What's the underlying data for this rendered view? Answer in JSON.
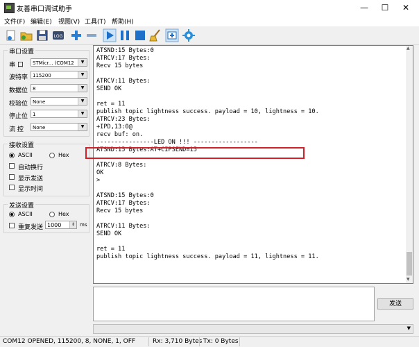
{
  "window": {
    "title": "友善串口调试助手"
  },
  "menu": [
    "文件(F)",
    "编辑(E)",
    "视图(V)",
    "工具(T)",
    "帮助(H)"
  ],
  "toolbar": {
    "icons": [
      "new-icon",
      "open-icon",
      "save-icon",
      "log-icon",
      "add-icon",
      "remove-icon",
      "run-icon",
      "pause-icon",
      "stop-icon",
      "clear-icon",
      "add-window-icon",
      "settings-icon"
    ]
  },
  "serial_settings": {
    "title": "串口设置",
    "port_label": "串  口",
    "port_value": "STMicr... (COM12",
    "baud_label": "波特率",
    "baud_value": "115200",
    "databits_label": "数据位",
    "databits_value": "8",
    "parity_label": "校验位",
    "parity_value": "None",
    "stopbits_label": "停止位",
    "stopbits_value": "1",
    "flow_label": "流  控",
    "flow_value": "None"
  },
  "receive_settings": {
    "title": "接收设置",
    "ascii": "ASCII",
    "hex": "Hex",
    "auto_wrap": "自动换行",
    "show_send": "显示发送",
    "show_time": "显示时间"
  },
  "send_settings": {
    "title": "发送设置",
    "ascii": "ASCII",
    "hex": "Hex",
    "repeat": "重复发送",
    "interval": "1000",
    "unit": "ms"
  },
  "console_text": "ATSND:15 Bytes:0\nATRCV:17 Bytes:\nRecv 15 bytes\n\nATRCV:11 Bytes:\nSEND OK\n\nret = 11\npublish topic lightness success. payload = 10, lightness = 10.\nATRCV:23 Bytes:\n+IPD,13:0@\nrecv buf: on.\n----------------LED ON !!! ------------------\nATSND:15 Bytes:AT+CIPSEND=15\n\nATRCV:8 Bytes:\nOK\n>\n\nATSND:15 Bytes:0\nATRCV:17 Bytes:\nRecv 15 bytes\n\nATRCV:11 Bytes:\nSEND OK\n\nret = 11\npublish topic lightness success. payload = 11, lightness = 11.",
  "send_button": "发送",
  "status": {
    "port_state": "COM12 OPENED, 115200, 8, NONE, 1, OFF",
    "rx": "Rx: 3,710 Bytes",
    "tx": "Tx: 0 Bytes"
  }
}
